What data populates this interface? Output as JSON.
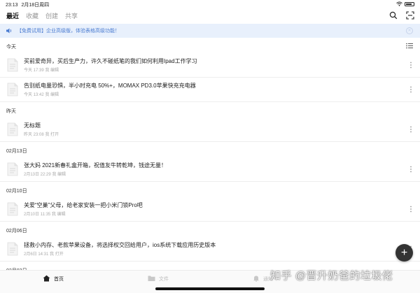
{
  "status_bar": {
    "time": "23:13",
    "date": "2月18日周四",
    "battery_level": 0.75
  },
  "nav": {
    "tabs": [
      {
        "label": "最近",
        "active": true
      },
      {
        "label": "收藏",
        "active": false
      },
      {
        "label": "创建",
        "active": false
      },
      {
        "label": "共享",
        "active": false
      }
    ],
    "icons": [
      "search-icon",
      "scan-icon"
    ]
  },
  "banner": {
    "text": "【免费试用】企业高级版，体验表格高级功能！"
  },
  "groups": [
    {
      "title": "今天",
      "items": [
        {
          "title": "买前爱奇异，买后生产力，许久不碰纸笔的我们如何利用Ipad工作学习",
          "meta": "今天 17:39 我 编辑"
        },
        {
          "title": "告别纸电量恐惧，半小时充电 50%+，MOMAX PD3.0苹果快充充电器",
          "meta": "今天 13:42 我 编辑"
        }
      ]
    },
    {
      "title": "昨天",
      "items": [
        {
          "title": "无标题",
          "meta": "昨天 23:08 我 打开"
        }
      ]
    },
    {
      "title": "02月13日",
      "items": [
        {
          "title": "张大妈 2021新春礼盒开箱，祝值友牛转乾坤，钱途无量！",
          "meta": "2月13日 22:29 我 编辑"
        }
      ]
    },
    {
      "title": "02月10日",
      "items": [
        {
          "title": "关爱“空巢”父母，给老家安装一把小米门锁Pro吧",
          "meta": "2月10日 11:35 我 编辑"
        }
      ]
    },
    {
      "title": "02月06日",
      "items": [
        {
          "title": "拯救小内存、老款苹果设备，将选择权交回给用户，ios系统下载应用历史版本",
          "meta": "2月6日 14:31 我 打开"
        }
      ]
    },
    {
      "title": "02月03日",
      "items": []
    }
  ],
  "bottom_tabs": [
    {
      "label": "首页",
      "icon": "home-icon",
      "active": true
    },
    {
      "label": "文件",
      "icon": "folder-icon",
      "active": false
    },
    {
      "label": "通知",
      "icon": "bell-icon",
      "active": false
    }
  ],
  "fab": {
    "label": "+"
  },
  "watermark": "知乎 @晋升奶爸的垃圾佬",
  "colors": {
    "accent": "#4a7bd0",
    "banner_bg": "#e8f0fc",
    "fab_bg": "#333333"
  }
}
